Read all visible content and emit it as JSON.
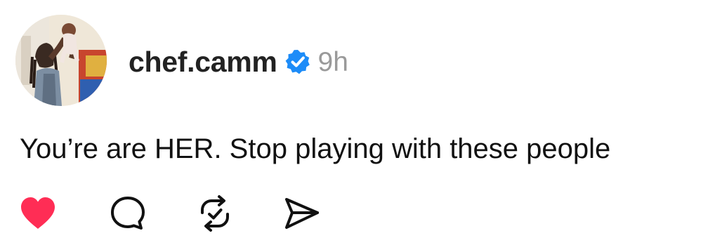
{
  "post": {
    "username": "chef.camm",
    "timestamp": "9h",
    "text": "You’re are HER. Stop playing with these people",
    "verified": true
  },
  "colors": {
    "like_red": "#ff2d55",
    "verified_blue": "#1d8cf8",
    "timestamp_gray": "#9a9a9a"
  },
  "icons": {
    "like": "heart-icon",
    "comment": "speech-bubble-icon",
    "repost": "repost-icon",
    "share": "paper-plane-icon",
    "verified": "verified-badge-icon"
  }
}
